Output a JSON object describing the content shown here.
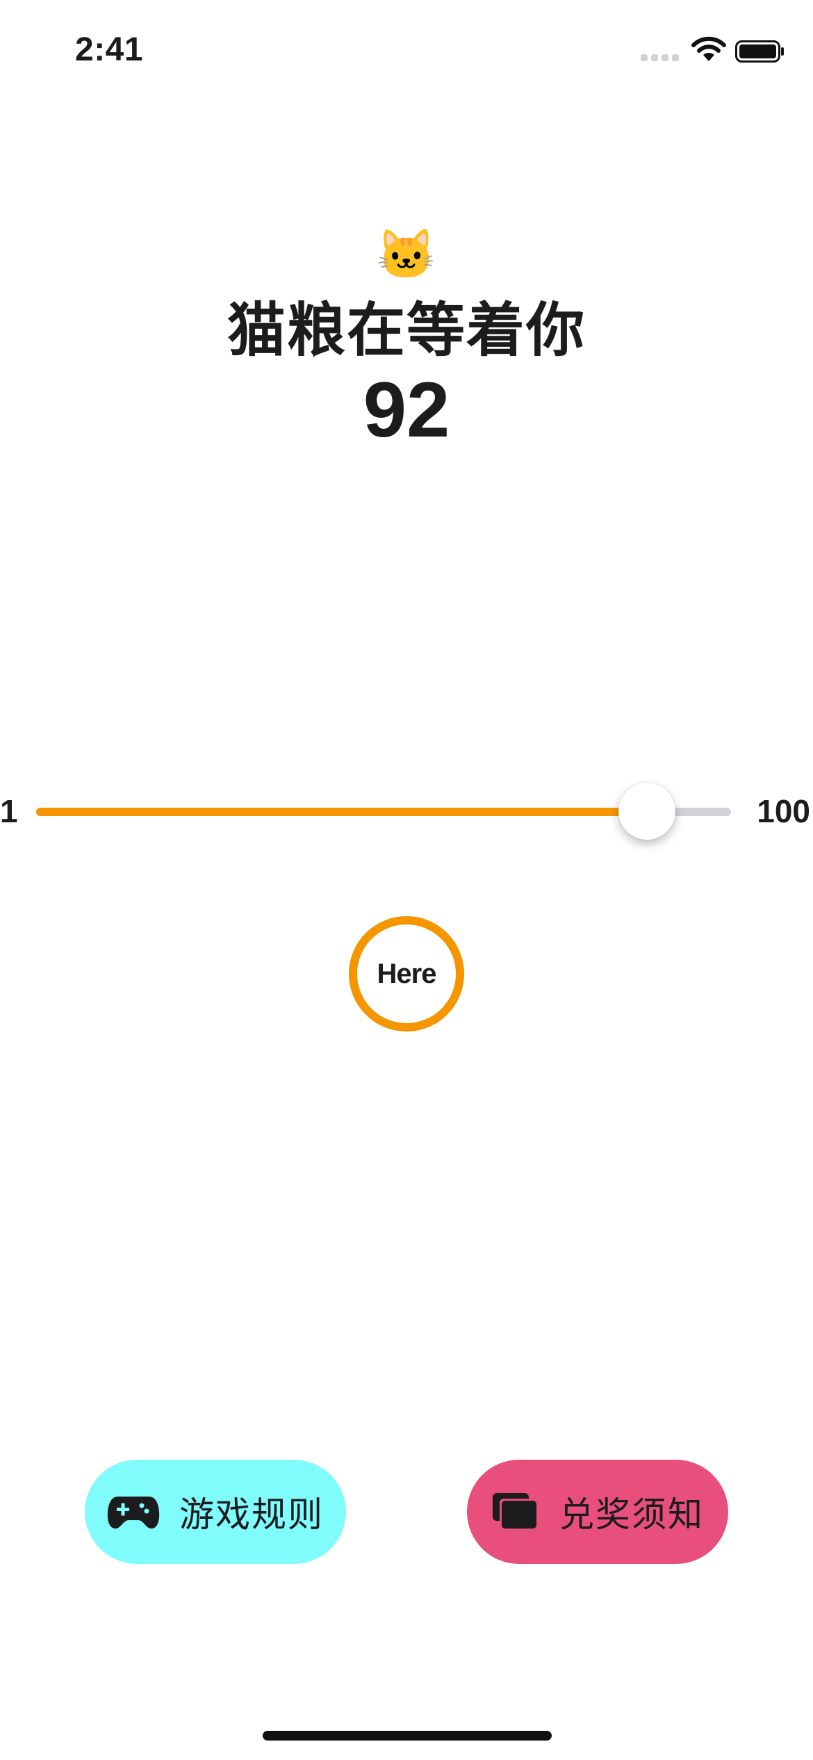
{
  "status_bar": {
    "time": "2:41"
  },
  "header": {
    "emoji": "🐱",
    "title": "猫粮在等着你",
    "score": "92"
  },
  "slider": {
    "min_label": "1",
    "max_label": "100",
    "value": 88,
    "min": 1,
    "max": 100,
    "fill_color": "#f59500",
    "track_color": "#d1d1d6"
  },
  "here_button": {
    "label": "Here",
    "ring_color": "#f59500"
  },
  "buttons": {
    "rules": {
      "label": "游戏规则",
      "icon": "gamepad-icon",
      "color": "#7ffcfb"
    },
    "redeem": {
      "label": "兑奖须知",
      "icon": "stacked-cards-icon",
      "color": "#e84f7c"
    }
  }
}
